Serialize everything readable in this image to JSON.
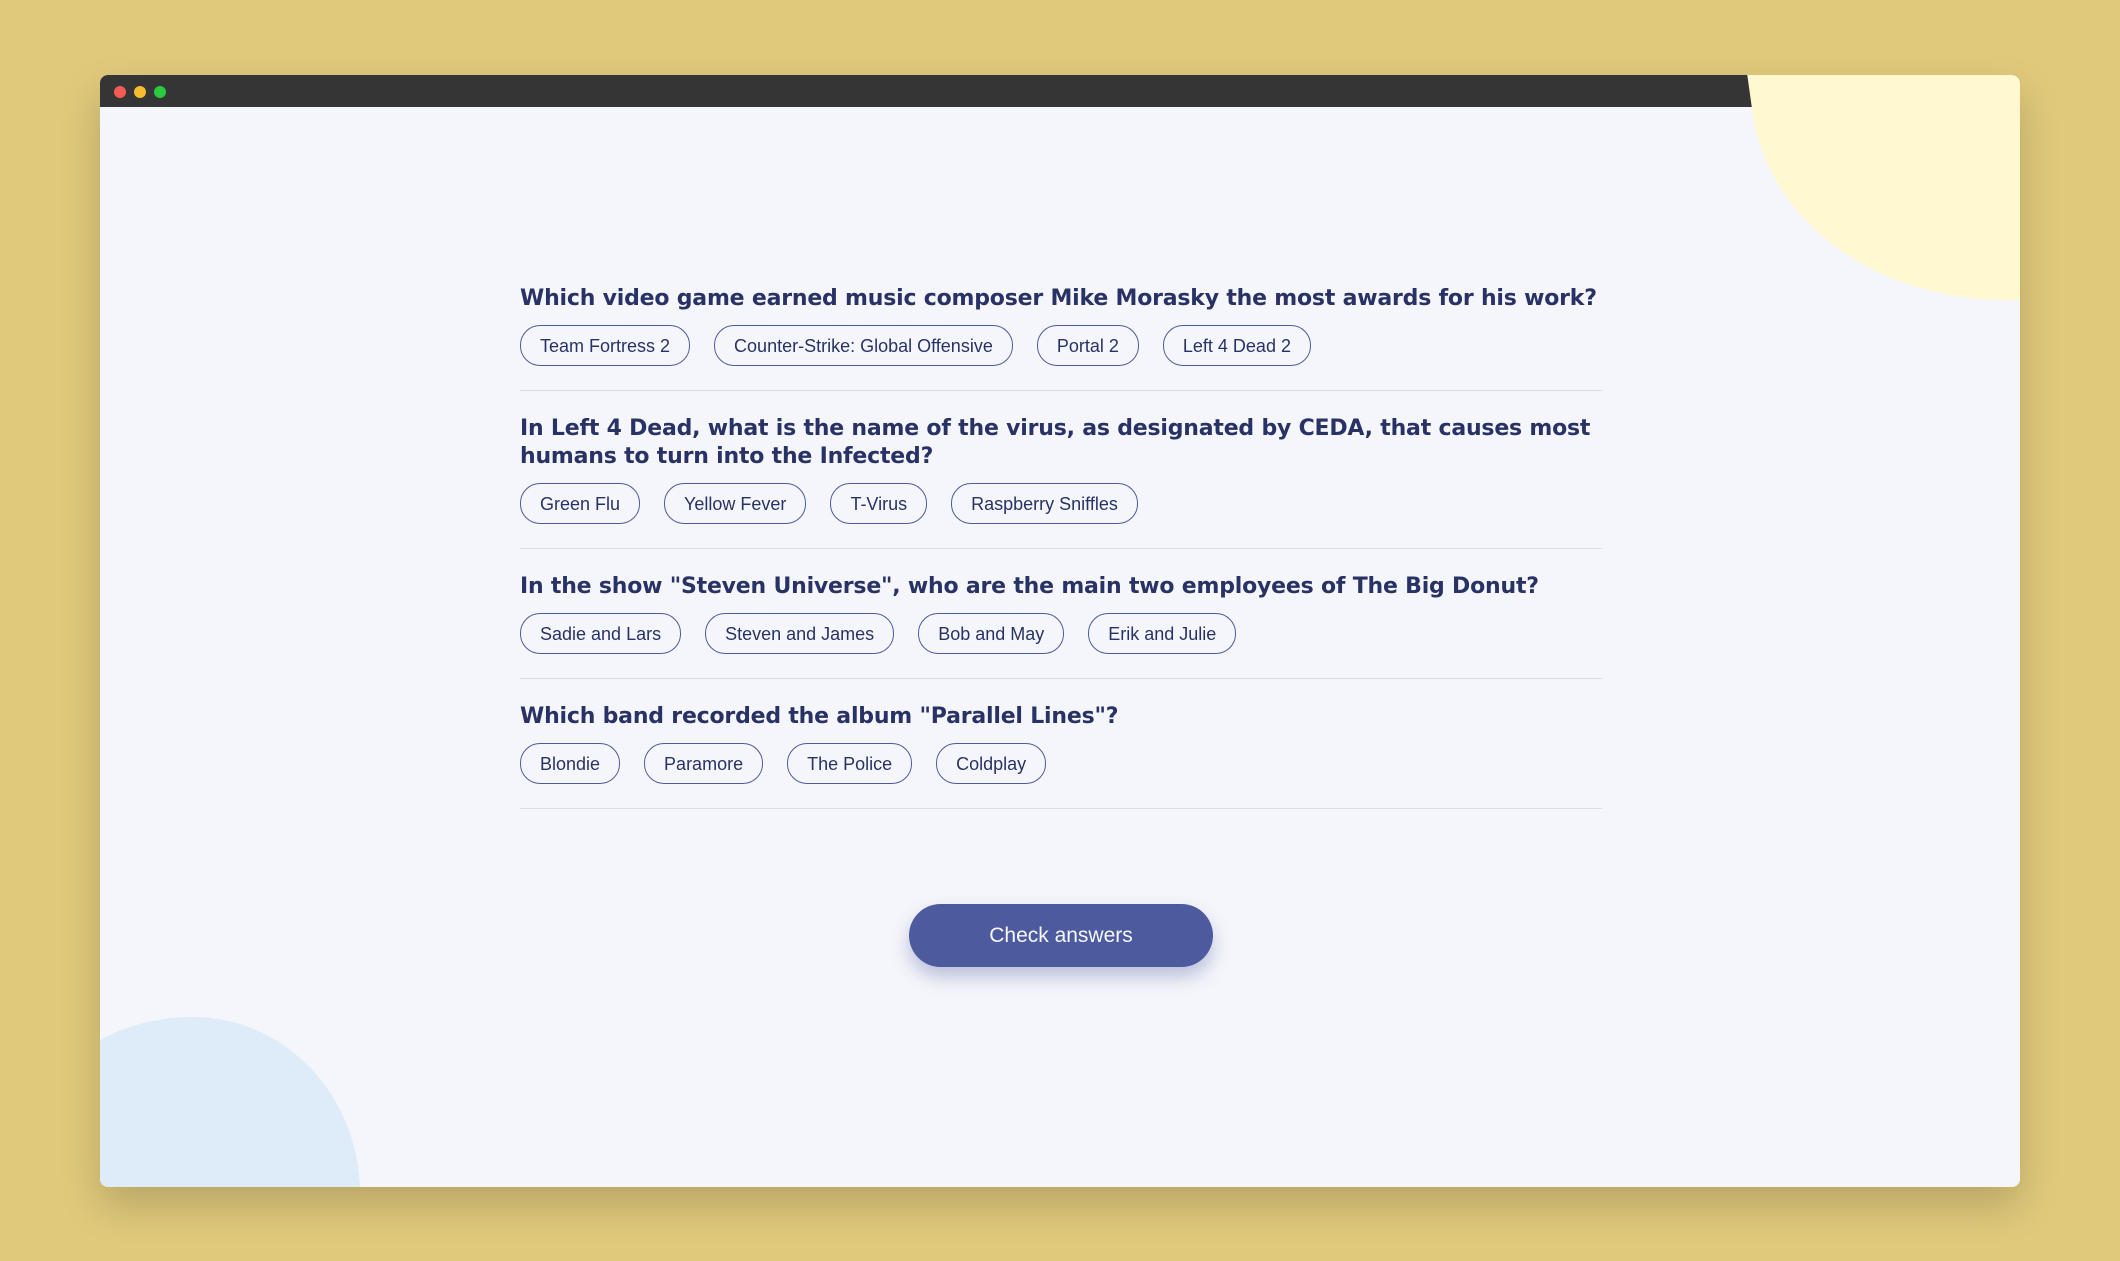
{
  "window": {
    "controls": [
      "close",
      "minimize",
      "maximize"
    ]
  },
  "colors": {
    "background": "#e0c97b",
    "page": "#f5f6fb",
    "accent": "#4d5b9e",
    "text": "#293264",
    "blob_yellow": "#fff8d0",
    "blob_blue": "#deebf8"
  },
  "questions": [
    {
      "text": "Which video game earned music composer Mike Morasky the most awards for his work?",
      "answers": [
        "Team Fortress 2",
        "Counter-Strike: Global Offensive",
        "Portal 2",
        "Left 4 Dead 2"
      ]
    },
    {
      "text": "In Left 4 Dead, what is the name of the virus, as designated by CEDA, that causes most humans to turn into the Infected?",
      "answers": [
        "Green Flu",
        "Yellow Fever",
        "T-Virus",
        "Raspberry Sniffles"
      ]
    },
    {
      "text": "In the show \"Steven Universe\", who are the main two employees of The Big Donut?",
      "answers": [
        "Sadie and Lars",
        "Steven and James",
        "Bob and May",
        "Erik and Julie"
      ]
    },
    {
      "text": "Which band recorded the album \"Parallel Lines\"?",
      "answers": [
        "Blondie",
        "Paramore",
        "The Police",
        "Coldplay"
      ]
    }
  ],
  "check_button_label": "Check answers"
}
